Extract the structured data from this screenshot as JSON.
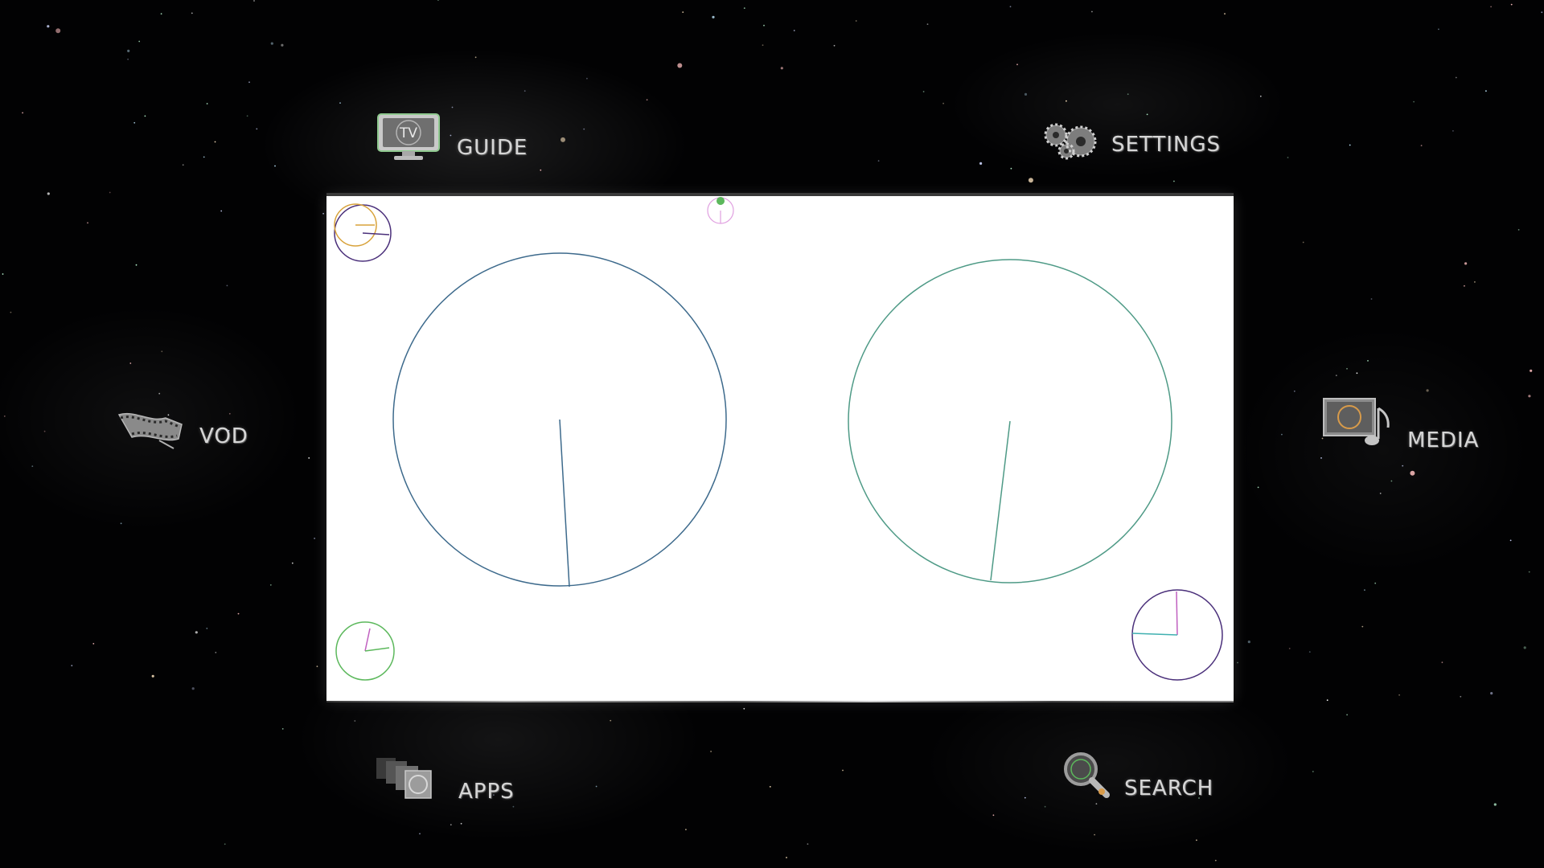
{
  "menu": {
    "guide": {
      "label": "GUIDE",
      "icon": "tv-icon",
      "badge": "TV"
    },
    "settings": {
      "label": "SETTINGS",
      "icon": "gear-icon"
    },
    "vod": {
      "label": "VOD",
      "icon": "film-strip-icon"
    },
    "media": {
      "label": "MEDIA",
      "icon": "music-note-icon"
    },
    "apps": {
      "label": "APPS",
      "icon": "stacked-cards-icon"
    },
    "search": {
      "label": "SEARCH",
      "icon": "magnifier-icon"
    }
  },
  "preview": {
    "background": "#ffffff",
    "gauge_colors": {
      "large_left": "#3d6a8c",
      "large_right": "#4e9a86",
      "top_left": "#d8a23a",
      "bottom_left": "#5cb85c",
      "bottom_right": "#6a4a9a",
      "top_center": "#e0a0e0"
    }
  },
  "colors": {
    "background": "#020203",
    "label": "#d6d6d6"
  }
}
